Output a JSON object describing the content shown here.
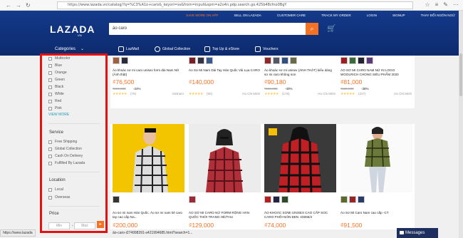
{
  "browser": {
    "url": "https://www.lazada.vn/catalog/?q=%C3%A1o+caro&_keyori=ss&from=input&spm=a2o4n.pdp.search.go.425b48cfno0BgY",
    "nav_back": "←",
    "nav_forward": "→",
    "nav_refresh": "↻",
    "lock_icon": "🔒",
    "tools": [
      "☆",
      "≡",
      "✎",
      "⋯"
    ]
  },
  "topnav": [
    "SAVE MORE ON APP",
    "SELL ON LAZADA",
    "CUSTOMER CARE",
    "TRACK MY ORDER",
    "LOGIN",
    "SIGNUP",
    "THAY ĐỔI NGÔN NGỮ"
  ],
  "logo": {
    "text": "LAZADA",
    "sub": ".VN"
  },
  "search": {
    "value": "áo caro",
    "button_icon": "⌕"
  },
  "cart_icon": "🛒",
  "categories_label": "Categories",
  "quick_links": [
    "LazMall",
    "Global Collection",
    "Top Up & eStore",
    "Vouchers"
  ],
  "sidebar": {
    "colors": [
      "Multicolor",
      "Blue",
      "Orange",
      "Green",
      "Black",
      "White",
      "Red",
      "Pink"
    ],
    "view_more": "VIEW MORE",
    "service_title": "Service",
    "service": [
      "Free Shipping",
      "Global Collection",
      "Cash On Delivery",
      "Fulfilled By Lazada"
    ],
    "location_title": "Location",
    "location": [
      "Local",
      "Overseas"
    ],
    "price_title": "Price",
    "price_min": "Min",
    "price_sep": "-",
    "price_max": "Max",
    "price_go": "▸"
  },
  "products_row1": [
    {
      "title": "Áo khoác sơ mi caro unisex form dài Nam Nữ (Ảnh thật)",
      "price": "₫76,500",
      "orig": "₫100,000",
      "disc": "-24%",
      "stars": "★★★★★",
      "reviews": "(79)",
      "loc": "Vietnam"
    },
    {
      "title": "Áo Sơ Mi Nam Dài Tay Hàn Quốc Vải Lụa CARO",
      "price": "₫140,000",
      "orig": "",
      "disc": "",
      "stars": "★★★★★",
      "reviews": "(50)",
      "loc": "Ho Chi Minh"
    },
    {
      "title": "Áo khoác sơ mi unisex (ẢNH THẬT) kiểu dáng sơ mi caro không non",
      "price": "₫90,180",
      "orig": "₫150,000",
      "disc": "-40%",
      "stars": "★★★★★",
      "reviews": "(176)",
      "loc": "Ho Chi Minh"
    },
    {
      "title": "ÁO SƠ MI CARO NAM NỮ IN LOGO WOOLRICH CHONG SIÊU PHẨM 2020",
      "price": "₫81,000",
      "orig": "₫130,000",
      "disc": "-38%",
      "stars": "★★★★★",
      "reviews": "(227)",
      "loc": "Ho Chi Minh"
    }
  ],
  "products_row2": [
    {
      "title": "Áo sơ mi nam Hàn Quốc. Áo sơ mi nam kẻ caro tay cao cấp Na...",
      "price": "₫200,000"
    },
    {
      "title": "ÁO SƠ MI CARO NỮ FORM RỘNG HÀN QUỐC THỜI TRANG HÈ/THU",
      "price": "₫129,000"
    },
    {
      "title": "ÁO KHOÁC SƠMI UNISEX CAO CẤP SOC CARO PHỐI NÓN ĐEN -ID065/2",
      "price": "₫74,000"
    },
    {
      "title": "Áo Sơ Mi Caro Nam cao cấp -CT",
      "price": "₫91,500"
    }
  ],
  "status_url": "https://www.lazada",
  "status_url2": "áo-caro-i274998391-s421994685.html?search=1...",
  "messages": "Messages",
  "colors": {
    "header": "#0d2a6e",
    "accent": "#f57224",
    "link": "#1a9cb7",
    "highlight_box": "#e51010"
  }
}
